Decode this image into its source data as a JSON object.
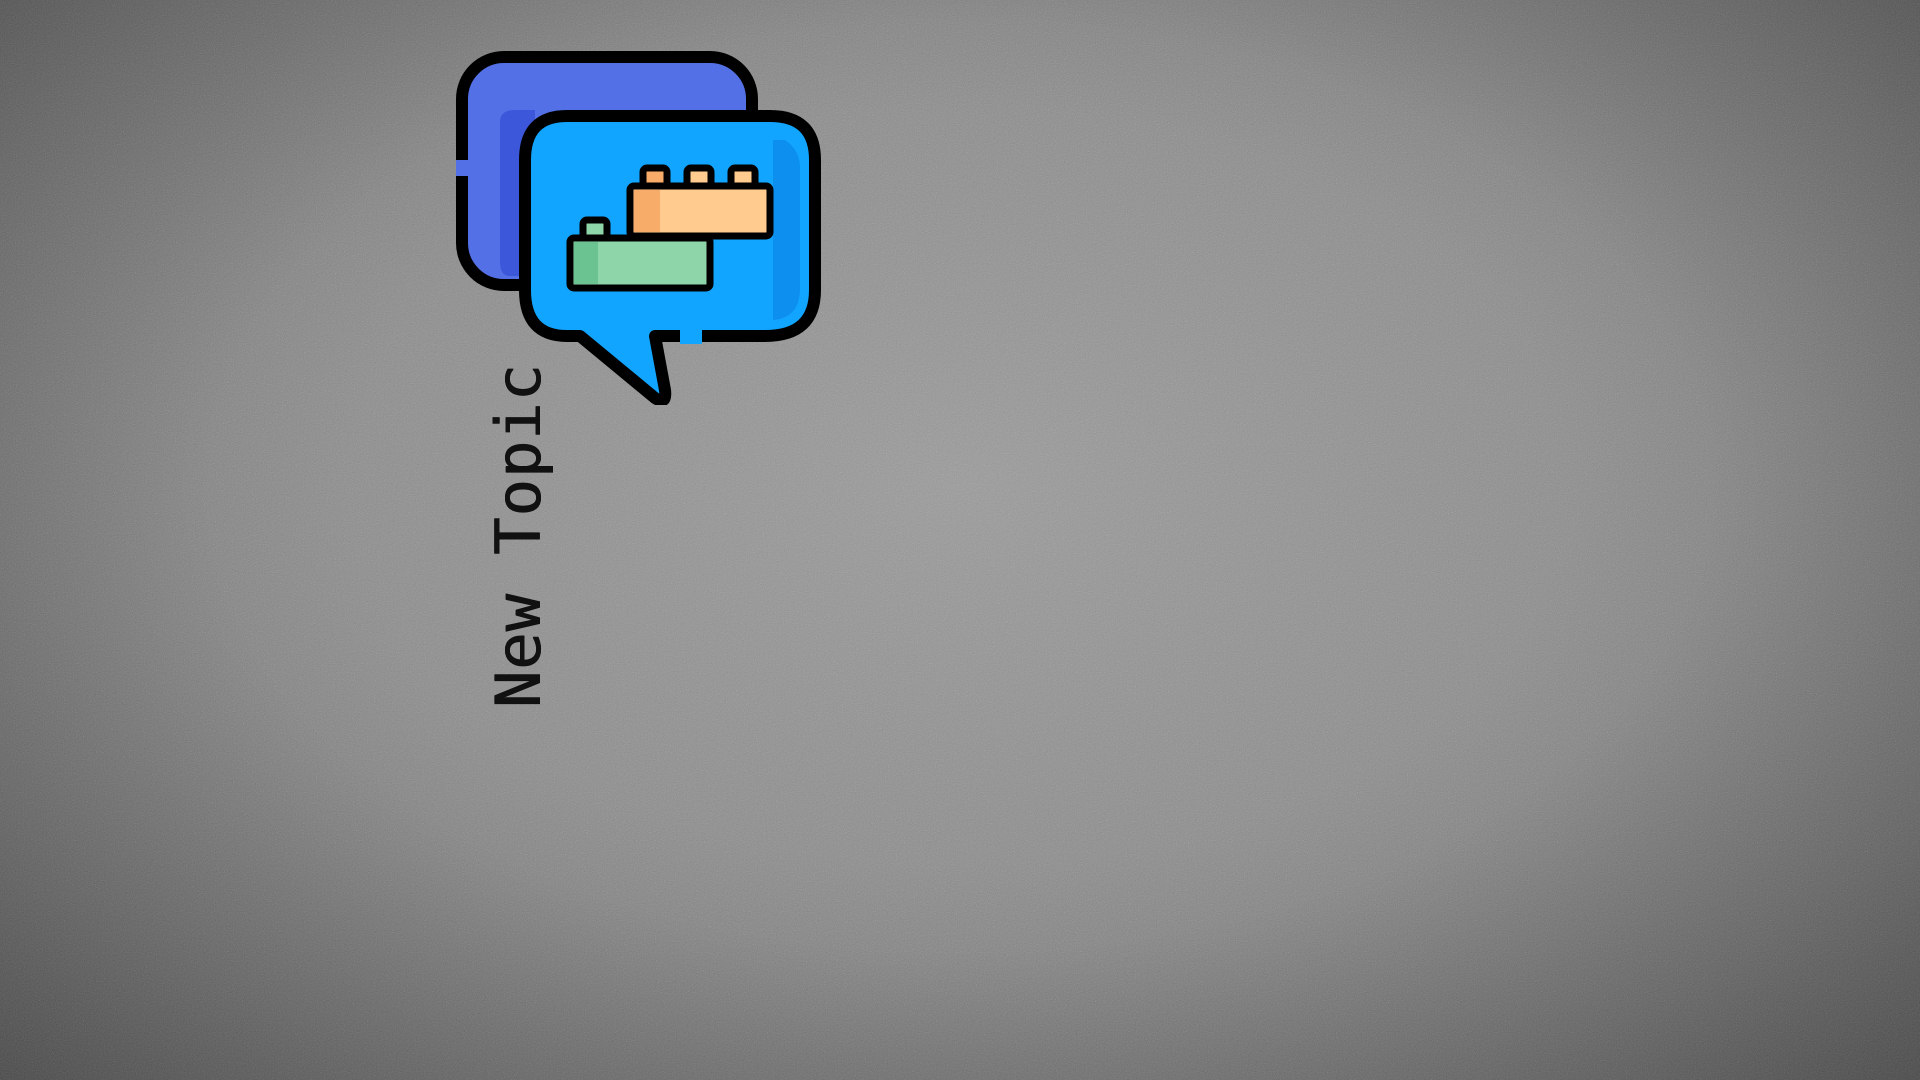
{
  "topic": {
    "label": "New Topic"
  },
  "icon": {
    "name": "chat-bubbles-blocks-icon",
    "colors": {
      "back_bubble": "#5470e6",
      "back_bubble_shade": "#3d57da",
      "front_bubble": "#12a5ff",
      "front_bubble_shade": "#0d8ff0",
      "orange_block": "#ffcb8e",
      "orange_block_shade": "#f8ac6a",
      "green_block": "#8fd5aa",
      "green_block_shade": "#6cc392",
      "outline": "#000000"
    }
  },
  "background": {
    "center": "#9a9a9a",
    "edge": "#5c5c5c"
  }
}
